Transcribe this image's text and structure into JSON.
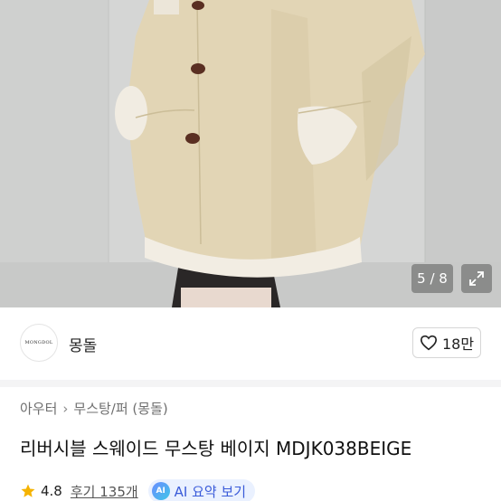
{
  "gallery": {
    "counter": "5 / 8",
    "image_alt": "Model wearing a beige suede shearling coat with brown buttons"
  },
  "shop": {
    "logo_text": "MONGDOL",
    "name": "몽돌",
    "likes": "18만"
  },
  "breadcrumb": {
    "items": [
      "아우터",
      "무스탕/퍼 (몽돌)"
    ]
  },
  "product": {
    "title": "리버시블 스웨이드 무스탕 베이지 MDJK038BEIGE"
  },
  "rating": {
    "score": "4.8",
    "reviews": "후기 135개",
    "ai_badge": "AI",
    "ai_label": "AI 요약 보기"
  },
  "colors": {
    "accent": "#3a5bd9",
    "star": "#f5b301",
    "coat": "#e0d3b2",
    "fleece": "#f1ece2"
  }
}
